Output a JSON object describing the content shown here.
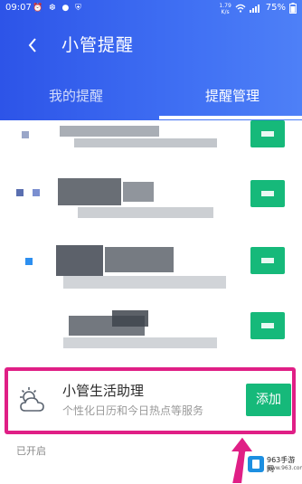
{
  "status_bar": {
    "time": "09:07",
    "left_icons": "⏰ ❆ ● ⛨",
    "net_speed_top": "1.79",
    "net_speed_bottom": "K/s",
    "battery": "75%"
  },
  "header": {
    "title": "小管提醒",
    "back_icon": "chevron-left-icon",
    "tabs": [
      {
        "label": "我的提醒",
        "active": false
      },
      {
        "label": "提醒管理",
        "active": true
      }
    ]
  },
  "feature": {
    "icon": "sun-cloud-icon",
    "name": "小管生活助理",
    "description": "个性化日历和今日热点等服务",
    "action_label": "添加"
  },
  "section_label": "已开启",
  "watermark": {
    "line1": "963手游网",
    "line2": "www.963.com"
  },
  "colors": {
    "header_start": "#2d54e8",
    "header_end": "#4e80f7",
    "add_button": "#16b97a",
    "highlight": "#e01f86",
    "arrow": "#e01f86"
  }
}
